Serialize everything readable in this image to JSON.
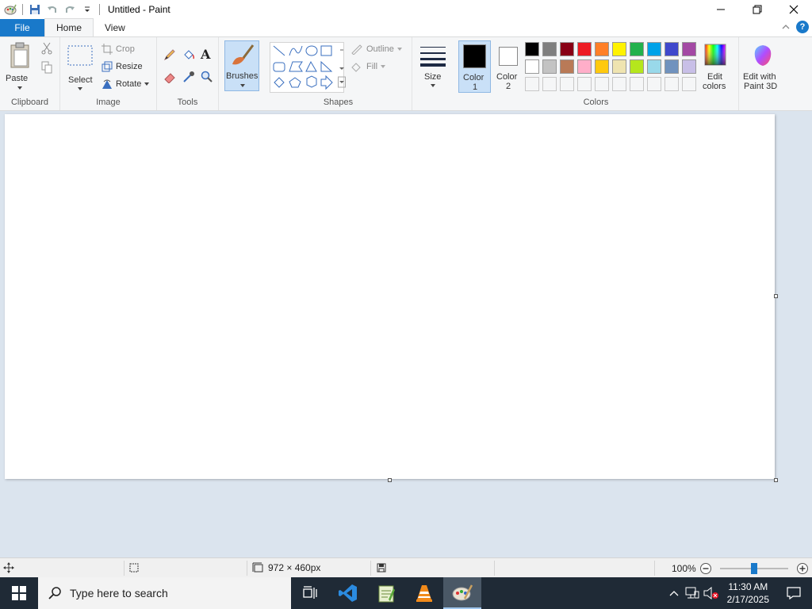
{
  "window": {
    "title": "Untitled - Paint"
  },
  "menu": {
    "file": "File",
    "home": "Home",
    "view": "View"
  },
  "clipboard": {
    "paste": "Paste",
    "group_label": "Clipboard"
  },
  "image": {
    "select": "Select",
    "crop": "Crop",
    "resize": "Resize",
    "rotate": "Rotate",
    "group_label": "Image"
  },
  "tools": {
    "group_label": "Tools",
    "text_tool": "A"
  },
  "brushes": {
    "label": "Brushes"
  },
  "shapes": {
    "outline": "Outline",
    "fill": "Fill",
    "group_label": "Shapes"
  },
  "size": {
    "label": "Size"
  },
  "color1": {
    "label_line1": "Color",
    "label_line2": "1",
    "value": "#000000"
  },
  "color2": {
    "label_line1": "Color",
    "label_line2": "2",
    "value": "#ffffff"
  },
  "colors": {
    "group_label": "Colors",
    "palette_row1": [
      "#000000",
      "#7f7f7f",
      "#880015",
      "#ed1c24",
      "#ff7f27",
      "#fff200",
      "#22b14c",
      "#00a2e8",
      "#3f48cc",
      "#a349a4"
    ],
    "palette_row2": [
      "#ffffff",
      "#c3c3c3",
      "#b97a57",
      "#ffaec9",
      "#ffc90e",
      "#efe4b0",
      "#b5e61d",
      "#99d9ea",
      "#7092be",
      "#c8bfe7"
    ],
    "edit_colors_line1": "Edit",
    "edit_colors_line2": "colors",
    "paint3d_line1": "Edit with",
    "paint3d_line2": "Paint 3D"
  },
  "status": {
    "dimensions": "972 × 460px",
    "zoom": "100%",
    "zoom_level": 1.0
  },
  "taskbar": {
    "search_placeholder": "Type here to search",
    "time": "11:30 AM",
    "date": "2/17/2025"
  }
}
